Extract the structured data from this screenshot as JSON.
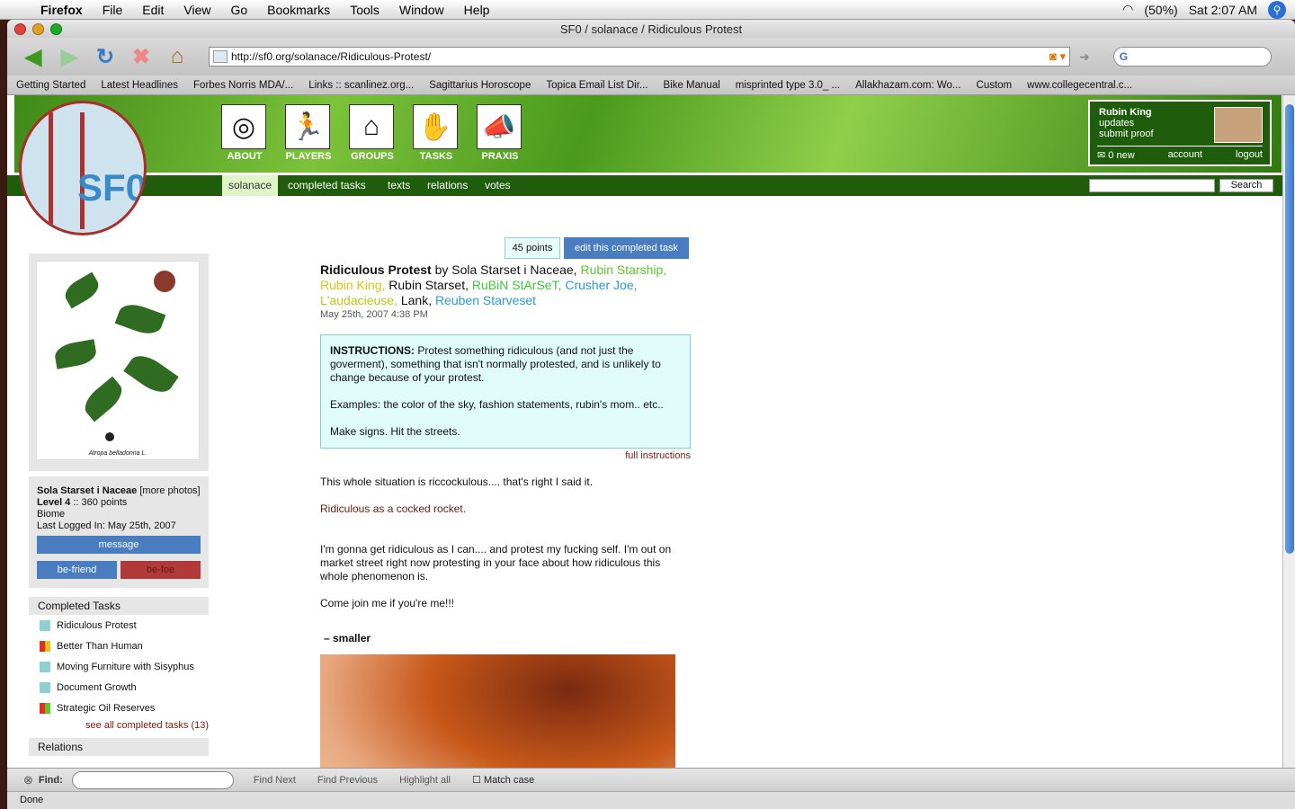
{
  "menubar": {
    "app": "Firefox",
    "items": [
      "File",
      "Edit",
      "View",
      "Go",
      "Bookmarks",
      "Tools",
      "Window",
      "Help"
    ],
    "battery": "(50%)",
    "clock": "Sat 2:07 AM"
  },
  "window": {
    "title": "SF0 / solanace / Ridiculous Protest"
  },
  "url": "http://sf0.org/solanace/Ridiculous-Protest/",
  "bookmarks": [
    "Getting Started",
    "Latest Headlines",
    "Forbes Norris MDA/...",
    "Links :: scanlinez.org...",
    "Sagittarius Horoscope",
    "Topica Email List Dir...",
    "Bike Manual",
    "misprinted type 3.0_ ...",
    "Allakhazam.com: Wo...",
    "Custom",
    "www.collegecentral.c..."
  ],
  "site": {
    "logo_text": "SF0",
    "icons": [
      {
        "label": "ABOUT",
        "icon": "target-icon"
      },
      {
        "label": "PLAYERS",
        "icon": "runner-icon"
      },
      {
        "label": "GROUPS",
        "icon": "houses-icon"
      },
      {
        "label": "TASKS",
        "icon": "handshake-icon"
      },
      {
        "label": "PRAXIS",
        "icon": "megaphone-icon"
      }
    ],
    "user": {
      "name": "Rubin King",
      "link1": "updates",
      "link2": "submit proof",
      "new": "0 new",
      "account": "account",
      "logout": "logout"
    },
    "tabs": [
      "solanace",
      "completed tasks",
      "texts",
      "relations",
      "votes"
    ],
    "search_btn": "Search"
  },
  "sidebar": {
    "photo_caption": "Atropa belladonna L.",
    "name": "Sola Starset i Naceae",
    "more": "[more photos]",
    "level": "Level 4",
    "points": ":: 360 points",
    "type": "Biome",
    "logged": "Last Logged In: May 25th, 2007",
    "message": "message",
    "befriend": "be-friend",
    "befoe": "be-foe",
    "completed_header": "Completed Tasks",
    "tasks": [
      "Ridiculous Protest",
      "Better Than Human",
      "Moving Furniture with Sisyphus",
      "Document Growth",
      "Strategic Oil Reserves"
    ],
    "see_all": "see all completed tasks (13)",
    "relations": "Relations"
  },
  "main": {
    "points": "45 points",
    "edit": "edit this completed task",
    "task_title": "Ridiculous Protest",
    "by": "by Sola Starset i Naceae,",
    "players": [
      "Rubin Starship,",
      "Rubin King,",
      "Rubin Starset,",
      "RuBiN StArSeT,",
      "Crusher Joe,",
      "L'audacieuse,",
      "Lank,",
      "Reuben Starveset"
    ],
    "date": "May 25th, 2007 4:38 PM",
    "instr_label": "INSTRUCTIONS:",
    "instr_text": " Protest something ridiculous (and not just the goverment), something that isn't normally protested, and is unlikely to change because of your protest.",
    "instr_ex": "Examples: the color of the sky, fashion statements, rubin's mom.. etc..",
    "instr_last": "Make signs. Hit the streets.",
    "full": "full instructions",
    "p1": "This whole situation is riccockulous.... that's right I said it.",
    "p2": "Ridiculous as a cocked rocket.",
    "p3": "I'm gonna get ridiculous as I can.... and protest my fucking self. I'm out on market street right now protesting in your face about how ridiculous this whole phenomenon is.",
    "p4": "Come join me if you're me!!!",
    "smaller": "– smaller"
  },
  "findbar": {
    "label": "Find:",
    "next": "Find Next",
    "prev": "Find Previous",
    "highlight": "Highlight all",
    "match": "Match case"
  },
  "status": "Done"
}
